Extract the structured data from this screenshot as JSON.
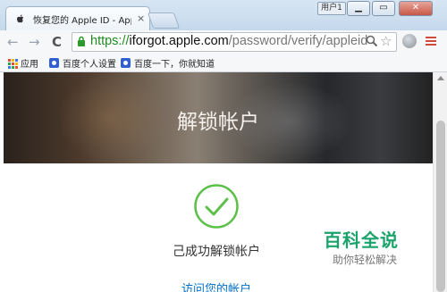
{
  "browser": {
    "tab_title": "恢复您的 Apple ID - Apple (",
    "tab_close": "×",
    "user_button": "用户1",
    "window_controls": {
      "minimize": "▁",
      "maximize": "▭",
      "close": "✕"
    },
    "address": {
      "scheme": "https://",
      "host": "iforgot.apple.com",
      "path": "/password/verify/appleid"
    },
    "nav_icons": {
      "back": "←",
      "forward": "→",
      "reload": "C"
    },
    "star": "☆"
  },
  "bookmarks": [
    {
      "label": "应用",
      "icon": "apps-grid-icon"
    },
    {
      "label": "百度个人设置",
      "icon": "baidu-paw-icon"
    },
    {
      "label": "百度一下，你就知道",
      "icon": "baidu-paw-icon"
    }
  ],
  "page": {
    "hero_title": "解锁帐户",
    "success_text": "己成功解锁帐户",
    "access_link": "访问您的帐户"
  },
  "watermark": {
    "title": "百科全说",
    "subtitle": "助你轻松解决"
  },
  "colors": {
    "accent_green": "#1e8b1e",
    "check_green": "#5cc04a",
    "link_blue": "#0070c9",
    "menu_red": "#d04a3a",
    "watermark_green": "#1aa36a"
  }
}
